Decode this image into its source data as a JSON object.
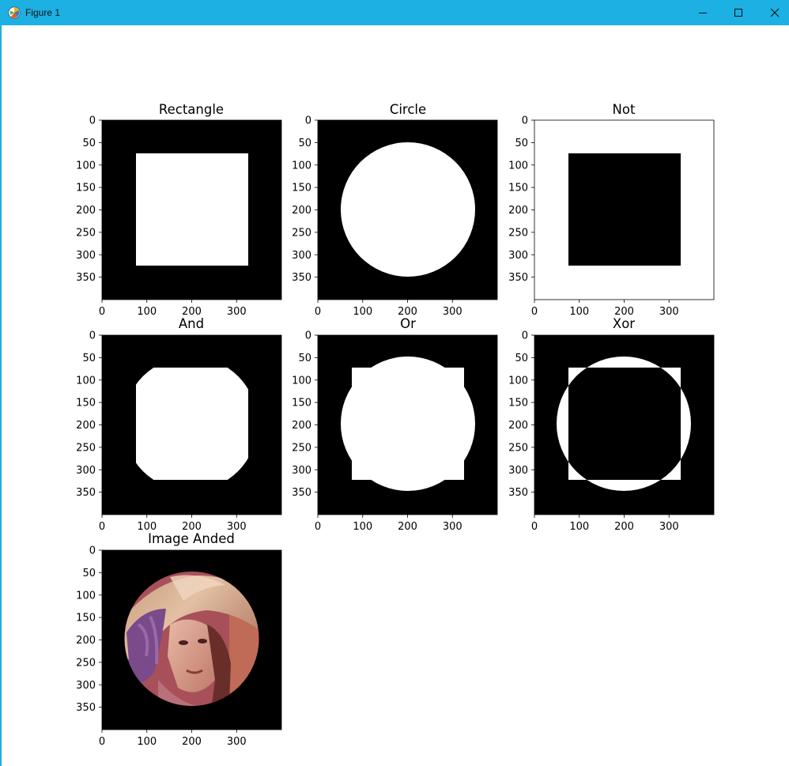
{
  "window": {
    "title": "Figure 1",
    "app_icon": "matplotlib-icon",
    "controls": [
      "minimize-icon",
      "maximize-icon",
      "close-icon"
    ],
    "titlebar_color": "#1cb0e3"
  },
  "figure": {
    "tick_labels": {
      "x": [
        "0",
        "100",
        "200",
        "300"
      ],
      "y": [
        "0",
        "50",
        "100",
        "150",
        "200",
        "250",
        "300",
        "350"
      ]
    },
    "panels": [
      {
        "title": "Rectangle",
        "content": "white rectangle on black background"
      },
      {
        "title": "Circle",
        "content": "white circle on black background"
      },
      {
        "title": "Not",
        "content": "black rectangle on white background"
      },
      {
        "title": "And",
        "content": "intersection of rectangle and circle"
      },
      {
        "title": "Or",
        "content": "union of rectangle and circle"
      },
      {
        "title": "Xor",
        "content": "exclusive or of rectangle and circle"
      },
      {
        "title": "Image Anded",
        "content": "photograph masked by circle"
      }
    ]
  }
}
